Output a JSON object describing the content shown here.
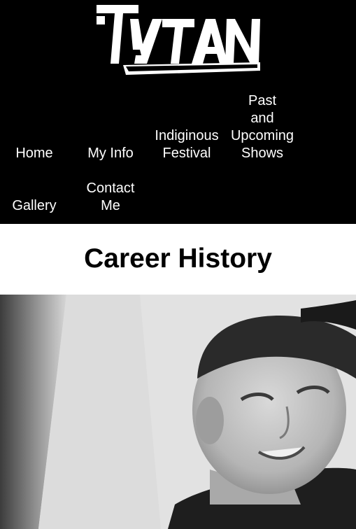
{
  "header": {
    "logo_icon": "tytan-logo-icon",
    "logo_text": "TYTAN",
    "background": "#000000"
  },
  "nav": {
    "home": "Home",
    "my_info": "My Info",
    "indiginous_festival": [
      "Indiginous",
      "Festival"
    ],
    "shows": [
      "Past",
      "and",
      "Upcoming",
      "Shows"
    ],
    "gallery": "Gallery",
    "contact": [
      "Contact",
      "Me"
    ]
  },
  "main": {
    "title": "Career History"
  },
  "photo": {
    "description_icon": "portrait-photo-icon",
    "tone": "black-and-white"
  }
}
